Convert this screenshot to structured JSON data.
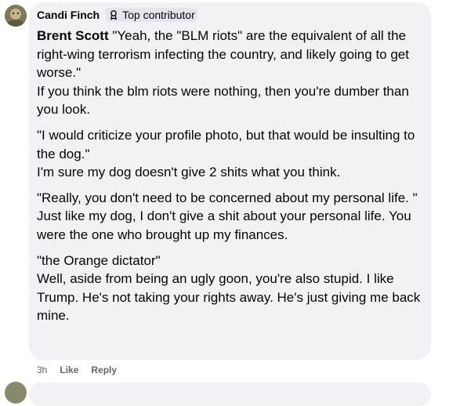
{
  "comment": {
    "author": "Candi Finch",
    "badge": {
      "icon": "contributor-badge-icon",
      "label": "Top contributor"
    },
    "mention": "Brent Scott",
    "paragraphs": [
      {
        "quote": " \"Yeah, the \"BLM riots\" are the equivalent of all the right-wing terrorism infecting the country, and likely going to get worse.\"",
        "reply": "If you think the blm riots were nothing, then you're dumber than you look."
      },
      {
        "quote": "\"I would criticize your profile photo, but that would be insulting to the dog.\"",
        "reply": "I'm sure my dog doesn't give 2 shits what you think."
      },
      {
        "quote": "\"Really, you don't need to be concerned about my personal life. \"",
        "reply": "Just like my dog, I don't give a shit about your personal life. You were the one who brought up my finances."
      },
      {
        "quote": "\"the Orange dictator\"",
        "reply": "Well, aside from being an ugly goon, you're also stupid. I like Trump. He's not taking your rights away. He's just giving me back mine."
      }
    ],
    "actions": {
      "time": "3h",
      "like": "Like",
      "reply": "Reply"
    }
  },
  "colors": {
    "bubble_bg": "#f0f2f5",
    "text": "#050505",
    "secondary_text": "#65676b",
    "badge_bg": "#e4e6eb"
  }
}
